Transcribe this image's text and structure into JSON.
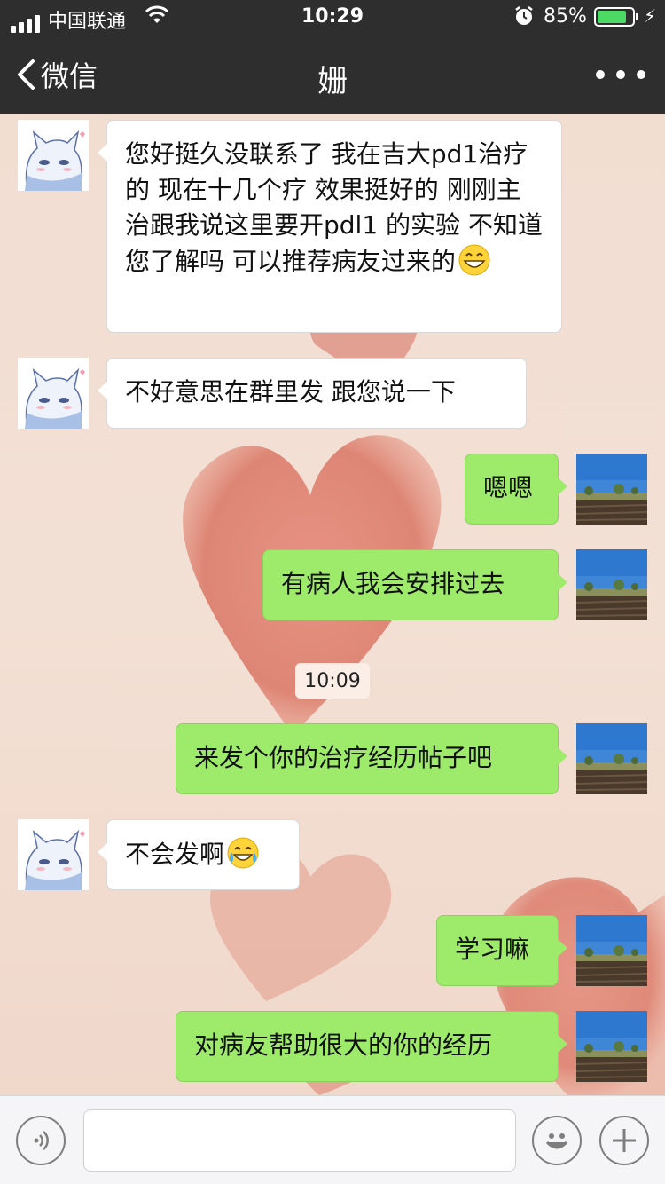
{
  "status_bar": {
    "carrier": "中国联通",
    "time": "10:29",
    "battery_percent": "85%",
    "battery_level": 0.85
  },
  "nav": {
    "back_label": "微信",
    "title": "姗"
  },
  "messages": [
    {
      "side": "in",
      "text": "您好挺久没联系了 我在吉大pd1治疗的 现在十几个疗 效果挺好的 刚刚主治跟我说这里要开pdl1 的实验 不知道您了解吗 可以推荐病友过来的",
      "emoji": "grinning-face"
    },
    {
      "side": "in",
      "text": "不好意思在群里发 跟您说一下"
    },
    {
      "side": "out",
      "text": "嗯嗯"
    },
    {
      "side": "out",
      "text": "有病人我会安排过去"
    },
    {
      "side": "out",
      "text": "来发个你的治疗经历帖子吧"
    },
    {
      "side": "in",
      "text": "不会发啊",
      "emoji": "tears-of-joy"
    },
    {
      "side": "out",
      "text": "学习嘛"
    },
    {
      "side": "out",
      "text": "对病友帮助很大的你的经历"
    }
  ],
  "timestamp_chip": "10:09",
  "input_bar": {
    "voice_icon": "voice-icon",
    "emoji_icon": "emoji-icon",
    "plus_icon": "plus-icon",
    "input_value": ""
  },
  "colors": {
    "nav_bg": "#2e2e2e",
    "outgoing_bubble": "#9eea6a",
    "incoming_bubble": "#ffffff",
    "battery_fill": "#4cd964"
  }
}
